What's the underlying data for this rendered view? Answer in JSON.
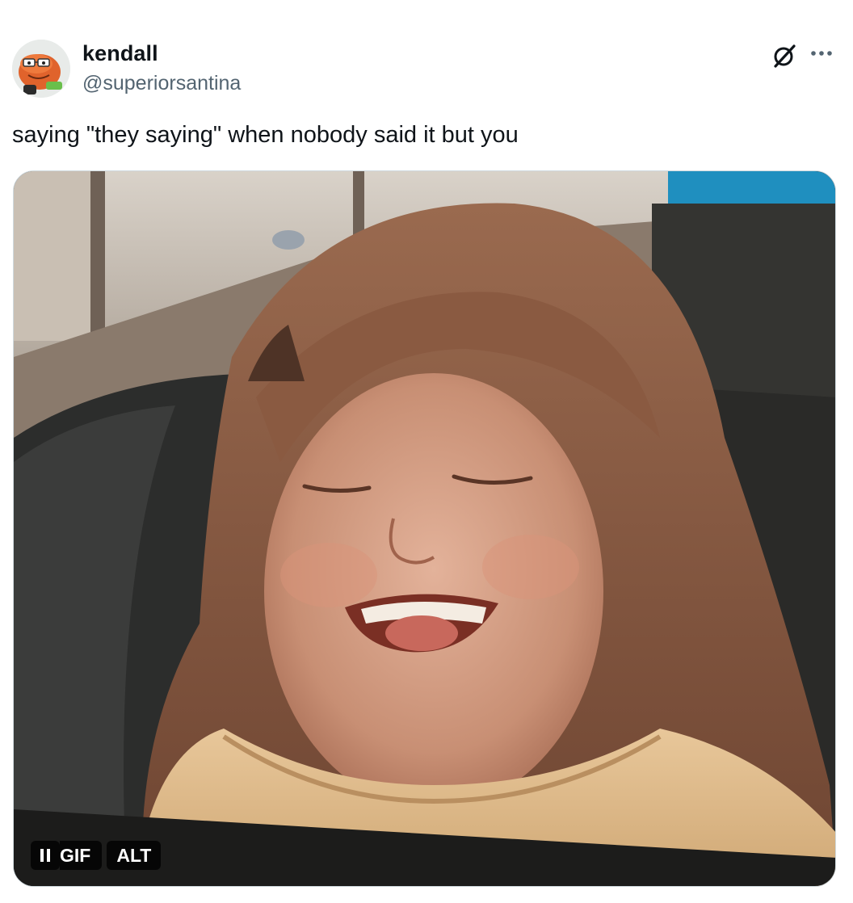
{
  "author": {
    "display_name": "kendall",
    "handle": "@superiorsantina"
  },
  "header_icons": [
    "grok-icon",
    "more-icon"
  ],
  "tweet": {
    "text": "saying \"they saying\" when nobody said it but you"
  },
  "media": {
    "type": "gif",
    "controls": {
      "pause_icon": "pause-icon",
      "gif_label": "GIF",
      "alt_label": "ALT"
    }
  },
  "colors": {
    "text_primary": "#0f1419",
    "text_secondary": "#536471",
    "border": "#cfd9de"
  }
}
